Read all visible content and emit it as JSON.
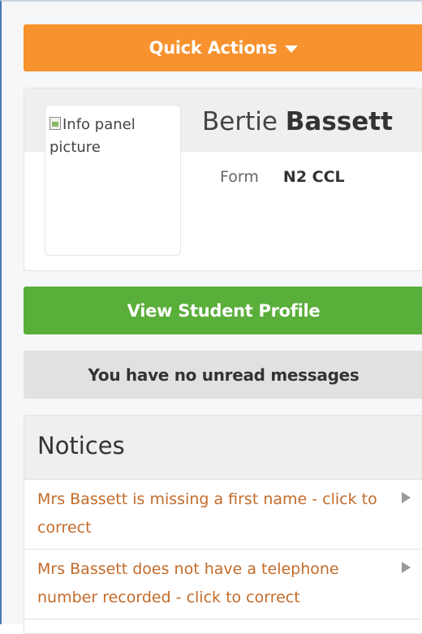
{
  "quick_actions": {
    "label": "Quick Actions",
    "icon": "caret-down-icon"
  },
  "info_panel": {
    "picture_alt": "Info panel picture",
    "first_name": "Bertie",
    "last_name": "Bassett",
    "form_label": "Form",
    "form_value": "N2 CCL"
  },
  "profile_button": {
    "label": "View Student Profile"
  },
  "messages": {
    "text": "You have no unread messages"
  },
  "notices": {
    "title": "Notices",
    "items": [
      {
        "text": "Mrs Bassett is missing a first name - click to correct"
      },
      {
        "text": "Mrs Bassett does not have a telephone number recorded - click to correct"
      }
    ]
  },
  "colors": {
    "accent_orange": "#f7922e",
    "accent_green": "#5aae3a",
    "notice_text": "#c36b2a"
  }
}
